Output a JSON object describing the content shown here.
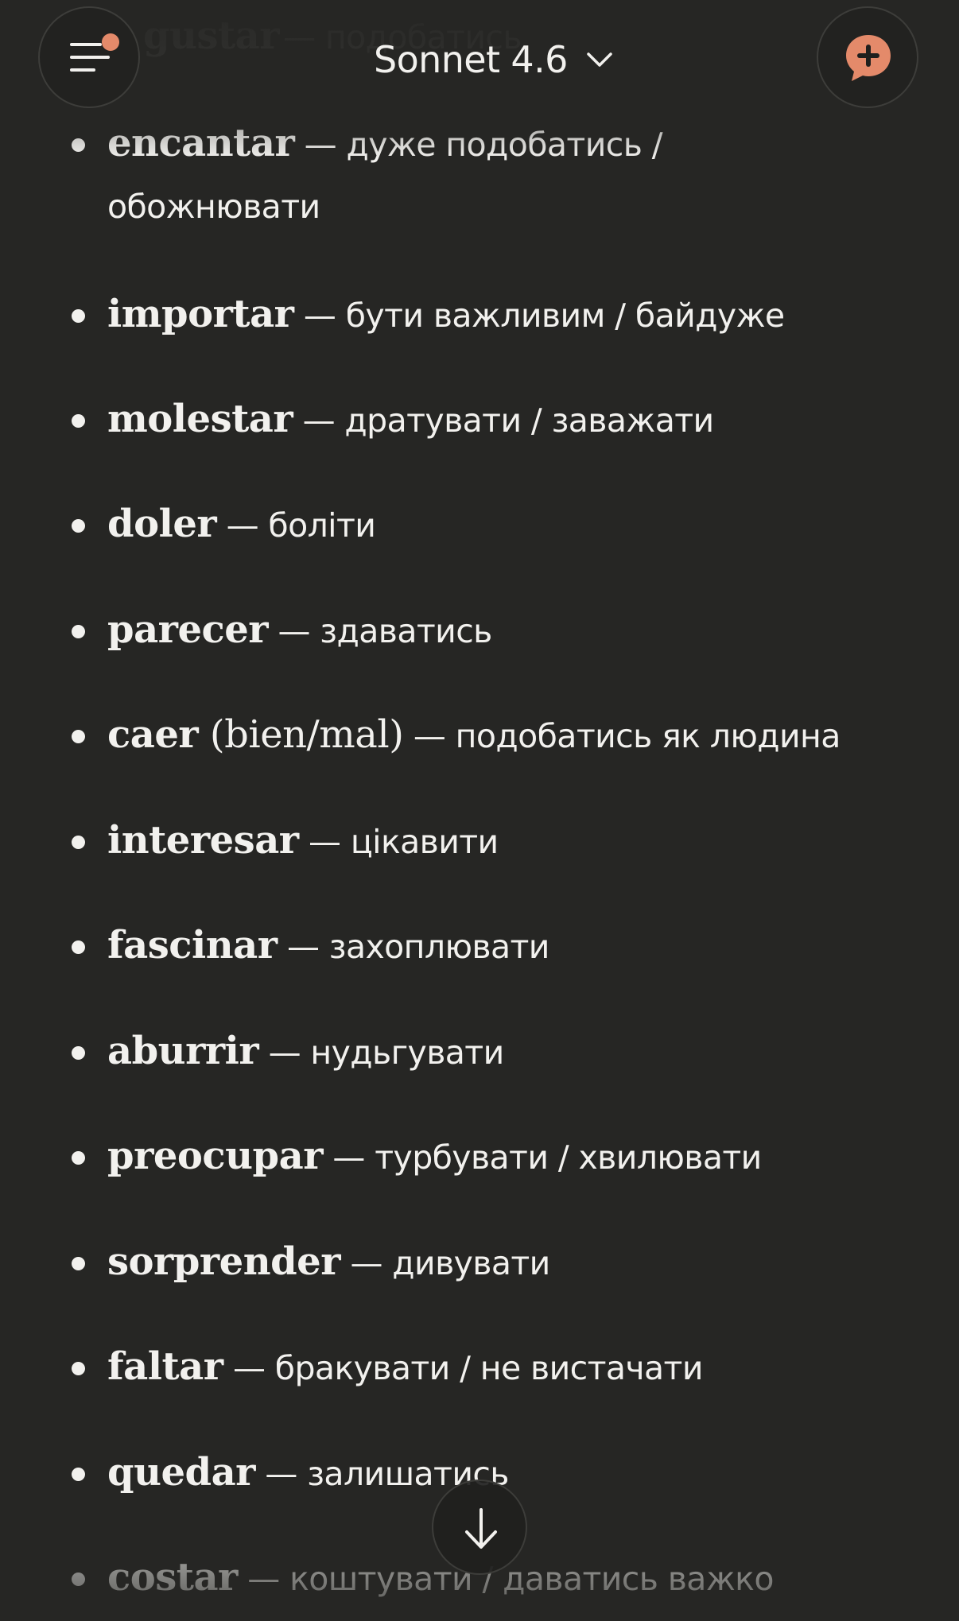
{
  "header": {
    "model_name": "Sonnet 4.6",
    "menu_has_notification": true,
    "accent_color": "#e48a6a"
  },
  "verbs": {
    "partial_previous": {
      "term": "gustar",
      "def": "— подобатись"
    },
    "items": [
      {
        "term": "encantar",
        "extra": "",
        "def": " — дуже подобатись /",
        "def2": "обожнювати"
      },
      {
        "term": "importar",
        "extra": "",
        "def": " — бути важливим / байдуже",
        "def2": ""
      },
      {
        "term": "molestar",
        "extra": "",
        "def": " — дратувати / заважати",
        "def2": ""
      },
      {
        "term": "doler",
        "extra": "",
        "def": " — боліти",
        "def2": ""
      },
      {
        "term": "parecer",
        "extra": "",
        "def": " — здаватись",
        "def2": ""
      },
      {
        "term": "caer",
        "extra": " (bien/mal)",
        "def": " — подобатись як людина",
        "def2": ""
      },
      {
        "term": "interesar",
        "extra": "",
        "def": " — цікавити",
        "def2": ""
      },
      {
        "term": "fascinar",
        "extra": "",
        "def": " — захоплювати",
        "def2": ""
      },
      {
        "term": "aburrir",
        "extra": "",
        "def": " — нудьгувати",
        "def2": ""
      },
      {
        "term": "preocupar",
        "extra": "",
        "def": " — турбувати / хвилювати",
        "def2": ""
      },
      {
        "term": "sorprender",
        "extra": "",
        "def": " — дивувати",
        "def2": ""
      },
      {
        "term": "faltar",
        "extra": "",
        "def": " — бракувати / не вистачати",
        "def2": ""
      },
      {
        "term": "quedar",
        "extra": "",
        "def": " — залишатись",
        "def2": ""
      },
      {
        "term": "costar",
        "extra": "",
        "def": " — коштувати / даватись важко",
        "def2": ""
      }
    ]
  },
  "icons": {
    "menu": "menu-icon",
    "model_dropdown": "chevron-down-icon",
    "new_chat": "new-chat-plus-icon",
    "scroll_down": "arrow-down-icon"
  }
}
